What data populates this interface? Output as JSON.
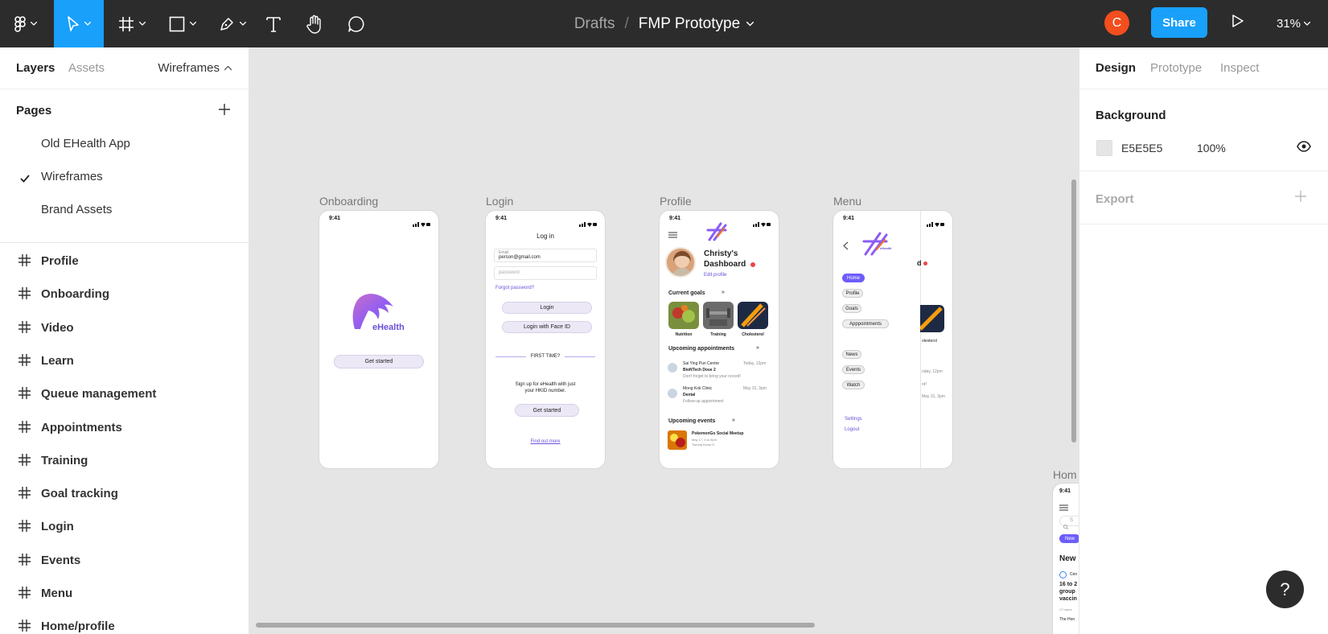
{
  "toolbar": {
    "tools": [
      {
        "name": "main-menu",
        "icon": "figma-logo-icon"
      },
      {
        "name": "move-tool",
        "icon": "cursor-icon",
        "active": true
      },
      {
        "name": "frame-tool",
        "icon": "frame-hash-icon"
      },
      {
        "name": "shape-tool",
        "icon": "rectangle-icon"
      },
      {
        "name": "pen-tool",
        "icon": "pen-icon"
      },
      {
        "name": "text-tool",
        "icon": "text-icon"
      },
      {
        "name": "hand-tool",
        "icon": "hand-icon"
      },
      {
        "name": "comment-tool",
        "icon": "comment-icon"
      }
    ],
    "breadcrumb_drafts": "Drafts",
    "breadcrumb_sep": "/",
    "file_name": "FMP Prototype",
    "avatar_initial": "C",
    "share_label": "Share",
    "zoom": "31%"
  },
  "left_panel": {
    "tabs": {
      "layers": "Layers",
      "assets": "Assets"
    },
    "current_page": "Wireframes",
    "pages_title": "Pages",
    "pages": [
      {
        "label": "Old EHealth App",
        "selected": false
      },
      {
        "label": "Wireframes",
        "selected": true
      },
      {
        "label": "Brand Assets",
        "selected": false
      }
    ],
    "layers": [
      "Profile",
      "Onboarding",
      "Video",
      "Learn",
      "Queue management",
      "Appointments",
      "Training",
      "Goal tracking",
      "Login",
      "Events",
      "Menu",
      "Home/profile"
    ]
  },
  "canvas": {
    "frames": {
      "onboarding": {
        "label": "Onboarding",
        "time": "9:41",
        "brand": "eHealth",
        "cta": "Get started"
      },
      "login": {
        "label": "Login",
        "time": "9:41",
        "title": "Log in",
        "email_label": "Email",
        "email_value": "person@gmail.com",
        "password_placeholder": "password",
        "forgot": "Forgot password?",
        "login_btn": "Login",
        "faceid_btn": "Login with Face ID",
        "divider": "FIRST TIME?",
        "signup_line1": "Sign up for eHealth with just",
        "signup_line2": "your HKID number.",
        "get_started": "Get started",
        "find_out": "Find out more"
      },
      "profile": {
        "label": "Profile",
        "time": "9:41",
        "greeting_line1": "Christy's",
        "greeting_line2": "Dashboard",
        "edit_profile": "Edit profile",
        "goals_title": "Current goals",
        "goals": [
          "Nutrition",
          "Training",
          "Cholesterol"
        ],
        "appointments_title": "Upcoming appointments",
        "appointments": [
          {
            "place": "Sai Ying Pun Centre",
            "when": "Today, 12pm",
            "title": "BioNTech Dose 2",
            "note": "Don't forget to bring your record!"
          },
          {
            "place": "Mong Kok Clinic",
            "when": "May 31, 3pm",
            "title": "Dental",
            "note": "Follow-up appointment"
          }
        ],
        "events_title": "Upcoming events",
        "event_title": "PokemonGo Social Meetup",
        "event_when": "May 17, 6 to 9pm",
        "event_where": "Tseung Kwan O"
      },
      "menu": {
        "label": "Menu",
        "time": "9:41",
        "items_primary": [
          "Home",
          "Profile",
          "Goals",
          "Apppointments"
        ],
        "items_secondary": [
          "News",
          "Events",
          "Watch"
        ],
        "settings": "Settings",
        "logout": "Logout",
        "peek_text": "olesterol",
        "peek_today": "oday, 12pm",
        "peek_date": "May 31, 3pm",
        "peek_r": "rd!"
      },
      "home": {
        "label": "Hom",
        "time": "9:41",
        "search_hint": "S",
        "badge": "New",
        "heading": "New",
        "source": "Cen",
        "headline_lines": [
          "16 to 2",
          "group",
          "vaccin"
        ],
        "meta": "17 hours",
        "footer": "The Hon"
      }
    }
  },
  "right_panel": {
    "tabs": {
      "design": "Design",
      "prototype": "Prototype",
      "inspect": "Inspect"
    },
    "background_title": "Background",
    "bg_hex": "E5E5E5",
    "bg_opacity": "100%",
    "export_title": "Export"
  },
  "help_label": "?",
  "colors": {
    "toolbar_bg": "#2c2c2c",
    "accent": "#18a0fb",
    "avatar": "#f24e1e",
    "canvas_bg": "#e5e5e5",
    "brand_purple": "#6b4fd8"
  }
}
